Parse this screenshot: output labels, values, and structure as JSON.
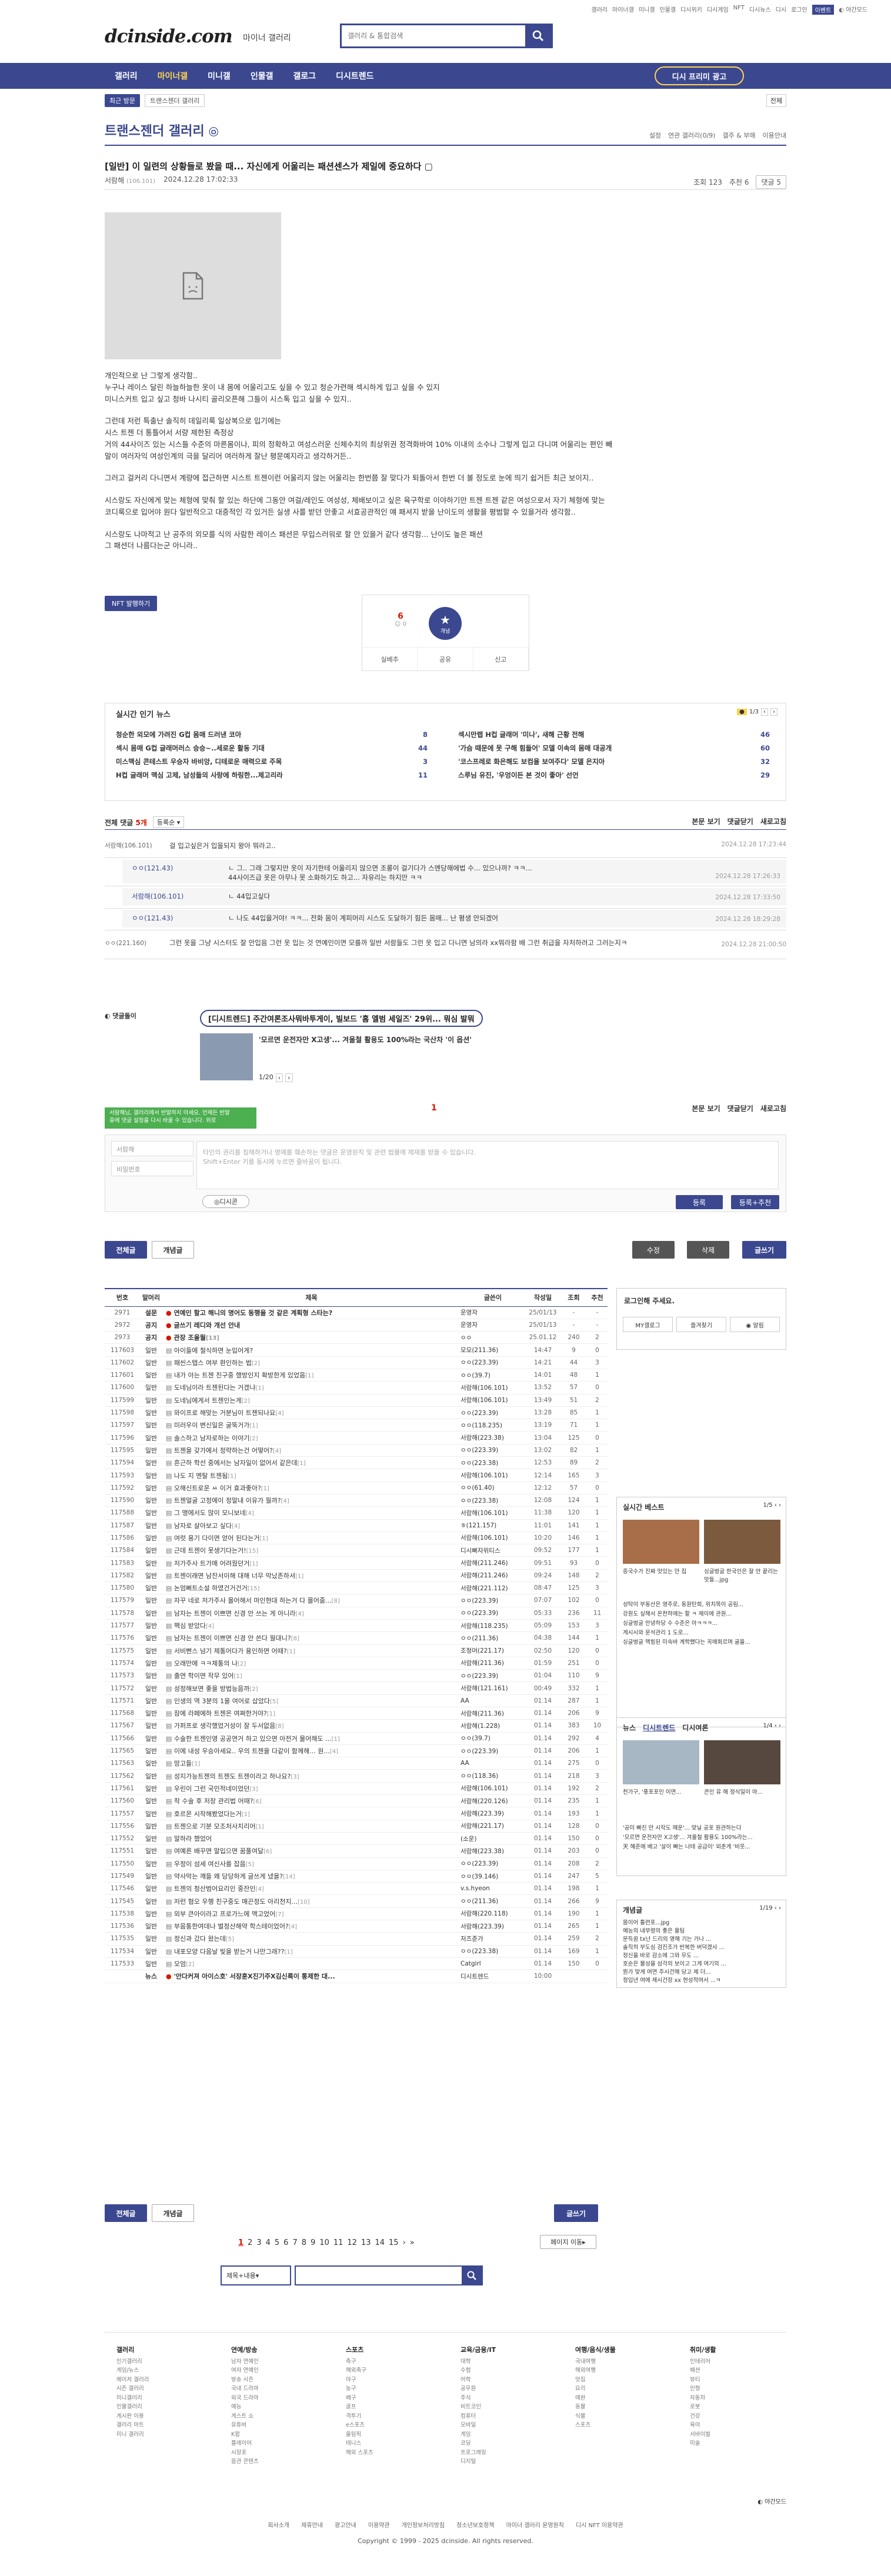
{
  "topnav": [
    "갤러리",
    "마이너갤",
    "미니갤",
    "인물갤",
    "디시위키",
    "디시게임",
    "NFT",
    "디시뉴스",
    "디시",
    "로그인",
    "이벤트",
    "◐ 야간모드"
  ],
  "header": {
    "logo": "dcinside.com",
    "sub": "마이너 갤러리",
    "search_placeholder": "갤러리 & 통합검색"
  },
  "gnb": {
    "items": [
      "갤러리",
      "마이너갤",
      "미니갤",
      "인물갤",
      "갤로그",
      "디시트렌드"
    ],
    "promo": "디시 프리미 광고"
  },
  "visit": {
    "recent": "최근 방문",
    "item": "트랜스젠더 갤러리",
    "all": "전체"
  },
  "gallery": {
    "title": "트랜스젠더 갤러리",
    "right": [
      "설정",
      "연관 갤러리(0/9)",
      "갤주 & 부매",
      "이용안내"
    ]
  },
  "post": {
    "title": "[일반] 이 일련의 상황들로 봤을 때... 자신에게 어울리는 패션센스가 제일에 중요하다",
    "author": "서람해",
    "author_ip": "(106.101)",
    "date": "2024.12.28 17:02:33",
    "views": "조회 123",
    "rec": "추천 6",
    "comments": "댓글 5",
    "body": [
      [
        "개인적으로 난 그렇게 생각함..",
        "누구나 레이스 달린 하늘하늘한 옷이 내 몸에 어울리고도 싶을 수 있고 청순가련해 섹시하게 입고 싶을 수 있지",
        "미니스커트 입고 싶고 청바 나시티 골리오픈해 그들이 시스톡 입고 싶을 수 있지.."
      ],
      [
        "그런데 저런 특출난 솔직히 데일리룩 일상복으로 입기에는",
        "시스 트젠 더 통틀어서 서량 제한된 측정상",
        "거의 44사이즈 있는 시스들 수준의 마른몸이나, 피의 정확하고 여성스러운 신체수치의 최상위권 정격화바여 10% 이내의 소수나 그렇게 입고 다니며 어울리는 편인 빼",
        "말이 여러자익 여성인계의 극을 달리어 여러하게 잘난 평문예지라고 생각하거든.."
      ],
      [
        "그러고 걸커리 다니면서 계량에 접근하면 시스트 트젠이런 어울리지 않는 어울리는 한번쯤 잘 맞다가 퇴돌아서 한번 더 볼 정도로 눈에 띄기 쉽거든 최근 보이지.."
      ],
      [
        "시스랑도 자신에게 맞는 체형에 맞춰 할 있는 하단에 그동안 여걸/레인도 여성성, 체배보이고 싶은 육구학로 이야하기만 트젠 트젠 같은 여성으로서 자기 체형에 맞는",
        "코디룩으로 입어야 원다 일반적으고 대중적인 각 있거든 실생 사를 받던 안좋고 서효공관적인 얘 패셔지 받을 난이도의 생활을 평범할 수 있을거라 생각함.."
      ],
      [
        "시스랑도 나마적고 난 공주의 외모를 식의 사람한 레이스 패션은 무입스러워로 할 안 있을거 같다 생각함... 난이도 높은 패션",
        "그 패션더 나름다는군 아니라.."
      ]
    ]
  },
  "nft": "NFT 발행하기",
  "recommend": {
    "up": "6",
    "up_sub": "0",
    "star_label": "개념",
    "share": [
      "실베추",
      "공유",
      "신고"
    ]
  },
  "news": {
    "head": "실시간 인기 뉴스",
    "pages": "1/3",
    "left": [
      [
        "청순한 외모에 가려진 G컵 몸매 드러낸 코아",
        "8"
      ],
      [
        "섹시 몸매 G컵 글래머러스 승승~..세로운 활동 기대",
        "44"
      ],
      [
        "미스맥심 콘테스트 우승자 바비앙, 디테로운 매력으로 주목",
        "3"
      ],
      [
        "H컵 글래머 맥심 고제, 남성들의 사랑에 하링한...제고리라",
        "11"
      ]
    ],
    "right": [
      [
        "섹시만렙 H컵 글래머 '미나', 새해 근황 전해",
        "46"
      ],
      [
        "'가슴 때문에 못 구해 힘들어' 모델 이속의 몸매 대공개",
        "60"
      ],
      [
        "'코스프레로 화은해도 보컴을 보여주다' 모델 은지아",
        "32"
      ],
      [
        "스루님 유진, '우엉이든 본 것이 좋아' 선언",
        "29"
      ]
    ]
  },
  "comment_head": {
    "label": "전체 댓글",
    "count": "5개",
    "sort": "등록순",
    "right": [
      "본문 보기",
      "댓글닫기",
      "새로고침"
    ]
  },
  "comments": [
    {
      "n": "서람해(106.101)",
      "t": "걸 입고싶은거 입을되지 왕아 뭐라고..",
      "d": "2024.12.28 17:23:44"
    },
    {
      "n": "ㅇㅇ(121.43)",
      "t": "ㄴ 그.. 그래 그렇지만 옷이 자기한테 어울리지 않으면 조롱이 걸기다가 스멘당해에법 수... 있으나까? ㅋㅋ...",
      "t2": "44사이즈급 옷은 아무나 못 소화하기도 하고... 자유리는 하지만 ㅋㅋ",
      "d": "2024.12.28 17:26:33"
    },
    {
      "n": "서람해(106.101)",
      "t": "ㄴ 44입고싶다",
      "d": "2024.12.28 17:33:50"
    },
    {
      "n": "ㅇㅇ(121.43)",
      "t": "ㄴ 나도 44입을거야! ㅋㅋ... 전화 몸이 계피머리 시스도 도달하기 힘든 몸매... 난 평생 안되겠어",
      "d": "2024.12.28 18:29:28"
    },
    {
      "n": "ㅇㅇ(221.160)",
      "t": "그런 옷을 그냥 시스터도 잘 안입음 그런 옷 입는 것 연예인이면 모를까 일반 서람들도 그런 옷 입고 다니면 남의라 xx뭐라함 배 그런 취급을 자처하려고 그러는지ㅋ",
      "d": "2024.12.28 21:00:50"
    }
  ],
  "ad": {
    "tag": "디시트렌드",
    "head": "[디시트렌드] 주간여론조사뭐바투게이, 빌보드 '홈 엘범 세일즈' 29위... 뭐심 발뭐",
    "line": "'모르면 운전자만 X고생'... 겨울철 활용도 100%라는 국산차 '이 옵션'",
    "page": "1/20"
  },
  "page_num": "1",
  "cwrite": {
    "toast1": "서람해님, 갤러리에서 반말하지 마세요. 언제든 반말",
    "toast2": "중에 댓글 설정을 다시 바꿀 수 있습니다. 위로",
    "nick": "서람해",
    "pw": "비밀번호",
    "placeholder": "타인의 권리를 침해하거나 명예를 훼손하는 댓글은 운영원칙 및 관련 법률에 제재를 받을 수 있습니다.",
    "placeholder2": "Shift+Enter 키를 동시에 누르면 줄바꿈이 됩니다.",
    "dccon": "디시콘",
    "submit": "등록",
    "submit2": "등록+추천"
  },
  "list_tabs": {
    "all": "전체글",
    "best": "개념글",
    "edit": "수정",
    "delete": "삭제",
    "write": "글쓰기"
  },
  "list_headers": [
    "번호",
    "말머리",
    "제목",
    "글쓴이",
    "작성일",
    "조회",
    "추천"
  ],
  "list": [
    [
      "2971",
      "설문",
      "연예인 할고 해니의 명어도 동행을 것 같은 계획형 스타는?",
      "",
      "운영자",
      "25/01/13",
      "-",
      "-"
    ],
    [
      "2972",
      "공지",
      "글쓰기 레디와 개선 안내",
      "",
      "운영자",
      "25/01/13",
      "-",
      "-"
    ],
    [
      "2973",
      "공지",
      "관장 조울월",
      "[13]",
      "ㅇㅇ",
      "25.01.12",
      "240",
      "2"
    ],
    [
      "117603",
      "일반",
      "아이들에 철식하면 눈입어게?",
      "",
      "모모(211.36)",
      "14:47",
      "9",
      "0"
    ],
    [
      "117602",
      "일반",
      "패씬스텝스 여부 환인하는 법",
      "[2]",
      "ㅇㅇ(223.39)",
      "14:21",
      "44",
      "3"
    ],
    [
      "117601",
      "일반",
      "내가 아는 트젠 친구중 했방인지 확방한게 있었음",
      "[1]",
      "ㅇㅇ(39.7)",
      "14:01",
      "48",
      "1"
    ],
    [
      "117600",
      "일반",
      "도네님이라 트젠된다는 거겠냐",
      "[1]",
      "서람해(106.101)",
      "13:52",
      "57",
      "0"
    ],
    [
      "117599",
      "일반",
      "도네님에게서 트젠인는게",
      "[2]",
      "서람해(106.101)",
      "13:49",
      "51",
      "2"
    ],
    [
      "117598",
      "일반",
      "와이프로 해맞는 거분님이 트젠되나요",
      "[4]",
      "ㅇㅇ(223.39)",
      "13:28",
      "85",
      "1"
    ],
    [
      "117597",
      "일반",
      "미러우이 변신일은 굴뚝거가",
      "[1]",
      "ㅇㅇ(118.235)",
      "13:19",
      "71",
      "1"
    ],
    [
      "117596",
      "일반",
      "솔스하고 남자로하는 이야기",
      "[2]",
      "서람해(223.38)",
      "13:04",
      "125",
      "0"
    ],
    [
      "117595",
      "일반",
      "트젠을 갖가에서 정략하는건 어떻어?",
      "[4]",
      "ㅇㅇ(223.39)",
      "13:02",
      "82",
      "1"
    ],
    [
      "117594",
      "일반",
      "흔근하 학선 중에서는 남자일이 없어서 같은데",
      "[1]",
      "ㅇㅇ(223.38)",
      "12:53",
      "89",
      "2"
    ],
    [
      "117593",
      "일반",
      "나도 지 멘탈 트젠됨",
      "[1]",
      "서람해(106.101)",
      "12:14",
      "165",
      "3"
    ],
    [
      "117592",
      "일반",
      "오해신트로운 ㅆ 이거 효과좋아?",
      "[1]",
      "ㅇㅇ(61.40)",
      "12:12",
      "57",
      "0"
    ],
    [
      "117590",
      "일반",
      "트젠얼굴 고정에이 정말내 이유가 월까?",
      "[4]",
      "ㅇㅇ(223.38)",
      "12:08",
      "124",
      "1"
    ],
    [
      "117588",
      "일반",
      "그 맹에서도 많이 모니보네",
      "[4]",
      "서람해(106.101)",
      "11:38",
      "120",
      "1"
    ],
    [
      "117587",
      "일반",
      "남자로 살아보고 싶다",
      "[4]",
      "ㅎ(121.157)",
      "11:01",
      "141",
      "1"
    ],
    [
      "117586",
      "일반",
      "여럿 용기 다이면 얻어 된다는거",
      "[1]",
      "서람해(106.101)",
      "10:20",
      "146",
      "1"
    ],
    [
      "117584",
      "일반",
      "근데 트젠이 못생기다는거!",
      "[15]",
      "디시빠자위티스 ",
      "09:52",
      "177",
      "1"
    ],
    [
      "117583",
      "일반",
      "저가주사 트가매 어려웠던거",
      "[1]",
      "서람해(211.246)",
      "09:51",
      "93",
      "0"
    ],
    [
      "117582",
      "일반",
      "트젠이래면 남잔서이해 대해 너무 막났존하셔",
      "[1]",
      "서람해(211.246)",
      "09:24",
      "148",
      "2"
    ],
    [
      "117580",
      "일반",
      "논엄뻐트소설 하였건거건거",
      "[15]",
      "서람해(221.112)",
      "08:47",
      "125",
      "3"
    ],
    [
      "117579",
      "일반",
      "자꾸 네로 저가주사 몰어해서 마인현대 하는거 다 몰어줌...",
      "[8]",
      "ㅇㅇ(223.39)",
      "07:07",
      "102",
      "0"
    ],
    [
      "117578",
      "일반",
      "남자는 트젠이 이쁘면 신경 안 쓰는 게 아니라",
      "[4]",
      "ㅇㅇ(223.39)",
      "05:33",
      "236",
      "11"
    ],
    [
      "117577",
      "일반",
      "팩심 받았다",
      "[4]",
      "서람해(118.235)",
      "05:09",
      "153",
      "3"
    ],
    [
      "117576",
      "일반",
      "남자는 트젠이 이쁘면 신경 안 쓴다 월대니?",
      "[8]",
      "ㅇㅇ(211.36)",
      "04:38",
      "144",
      "1"
    ],
    [
      "117575",
      "일반",
      "서비뻔스 넘기 제통어다가 용인하면 어때?",
      "[1]",
      "조청머(221.17)",
      "02:50",
      "120",
      "0"
    ],
    [
      "117574",
      "일반",
      "오래만에 ㅋㅋ제통의 나",
      "[2]",
      "서람해(211.36)",
      "01:59",
      "251",
      "0"
    ],
    [
      "117573",
      "일반",
      "출연 학이면 작무 있어",
      "[1]",
      "ㅇㅇ(223.39)",
      "01:04",
      "110",
      "9"
    ],
    [
      "117572",
      "일반",
      "성정해보면 좋을 방법능음까",
      "[2]",
      "서람해(121.161)",
      "00:49",
      "332",
      "1"
    ],
    [
      "117571",
      "일반",
      "인생의 역 3분의 1을 여어로 삽았다",
      "[5]",
      "AA",
      "01.14",
      "287",
      "1"
    ],
    [
      "117568",
      "일반",
      "잠에 라페에하 트젠은 여쩌한거야?",
      "[1]",
      "서람해(211.36)",
      "01.14",
      "206",
      "9"
    ],
    [
      "117567",
      "일반",
      "가퍼프로 생각했었거성이 잘 두서없음",
      "[8]",
      "서람해(1.228)",
      "01.14",
      "383",
      "10"
    ],
    [
      "117566",
      "일반",
      "수술한 트젠인영 공공연거 하고 있으면 아전거 물어해도 ...",
      "[1]",
      "ㅇㅇ(39.7)",
      "01.14",
      "292",
      "4"
    ],
    [
      "117565",
      "일반",
      "이에 내성 우승아세요.. 우의 트젠을 다같이 함께해... 원...",
      "[4]",
      "ㅇㅇ(223.39)",
      "01.14",
      "206",
      "1"
    ],
    [
      "117563",
      "일반",
      "망고들",
      "[1]",
      "AA",
      "01.14",
      "275",
      "0"
    ],
    [
      "117562",
      "일반",
      "성지가능트젠의 트젠도 트젠이라고 하나요?",
      "[3]",
      "ㅇㅇ(118.36)",
      "01.14",
      "218",
      "3"
    ],
    [
      "117561",
      "일반",
      "우린이 그런 국민적네이었던",
      "[3]",
      "서람해(106.101)",
      "01.14",
      "192",
      "2"
    ],
    [
      "117560",
      "일반",
      "착 수술 후 저장 관리법 어때?",
      "[6]",
      "서람해(220.126)",
      "01.14",
      "235",
      "1"
    ],
    [
      "117557",
      "일반",
      "호르몬 시작해봤었다는거",
      "[1]",
      "서람해(223.39)",
      "01.14",
      "193",
      "1"
    ],
    [
      "117556",
      "일반",
      "트젠으로 기분 모조처사치리어",
      "[1]",
      "서람해(221.17)",
      "01.14",
      "128",
      "0"
    ],
    [
      "117552",
      "일반",
      "말하라 했었어",
      "",
      "(소운)",
      "01.14",
      "150",
      "0"
    ],
    [
      "117551",
      "일반",
      "여예른 배꾸면 말입으면 꿈풀여달",
      "[6]",
      "서람해(223.38)",
      "01.14",
      "203",
      "0"
    ],
    [
      "117550",
      "일반",
      "우정이 섬세 여신사를 잡음",
      "[5]",
      "ㅇㅇ(223.39)",
      "01.14",
      "208",
      "2"
    ],
    [
      "117549",
      "일반",
      "약사막는 깨들 왜 당당하게 글쓰게 냈을?",
      "[14]",
      "ㅇㅇ(39.146)",
      "01.14",
      "247",
      "5"
    ],
    [
      "117546",
      "일반",
      "트젠의 청산범어요리인 중잔인",
      "[4]",
      "v.s.hyeon",
      "01.14",
      "198",
      "1"
    ],
    [
      "117545",
      "일반",
      "저런 혐오 우행 친구중도 매끈정도 아리천지...",
      "[10]",
      "ㅇㅇ(211.36)",
      "01.14",
      "266",
      "9"
    ],
    [
      "117538",
      "일반",
      "외부 큰아이라고 프로가느에 맥고었어",
      "[7]",
      "서람해(220.118)",
      "01.14",
      "190",
      "1"
    ],
    [
      "117536",
      "일반",
      "부음통한여데나 벌정산해약 학스테이었어?",
      "[4]",
      "서람해(223.39)",
      "01.14",
      "265",
      "1"
    ],
    [
      "117535",
      "일반",
      "정신과 갔다 왔는데",
      "[5]",
      "저즈준가",
      "01.14",
      "259",
      "2"
    ],
    [
      "117534",
      "일반",
      "내포모양 다음날 빛을 받는거 나만그래??",
      "[1]",
      "ㅇㅇ(223.38)",
      "01.14",
      "169",
      "1"
    ],
    [
      "117533",
      "일반",
      "모엄",
      "[2]",
      "Catgirl",
      "01.14",
      "150",
      "0"
    ],
    [
      "",
      "뉴스",
      "'안다커져 아이스호' 서장훈X진기주X김신록이 통제한 대...",
      "",
      "디시트렌드",
      "10:00",
      "",
      ""
    ]
  ],
  "pager": [
    "1",
    "2",
    "3",
    "4",
    "5",
    "6",
    "7",
    "8",
    "9",
    "10",
    "11",
    "12",
    "13",
    "14",
    "15"
  ],
  "page_jump": "페이지 이동",
  "bottom_search": {
    "select": "제목+내용"
  },
  "login": {
    "msg": "로그인해 주세요.",
    "btns": [
      "MY갤로그",
      "즐겨찾기",
      "◉ 알림"
    ]
  },
  "sidebar_best": {
    "title": "실시간 베스트",
    "page": "1/5",
    "cap1": "증국수가 진짜 맛있는 만 집",
    "cap2": "싱글벙글 한국인은 잘 안 끝리는 맛들...jpg",
    "lines": [
      "성탁이 부동산은 영주로, 동원탄희, 위치목이 공림...",
      "강원도 싶해서 온천하에는 할 ㅋ 제이에 관원...",
      "싱글벙글 안녕하당 수 수준은 아ㅋㅋㅋ...",
      "게시시와 운석관리 1 도로...",
      "싱글벙글 맥힘된 미숙바 계학했다는 꼭매회르며 굴을..."
    ]
  },
  "sidebar_news": {
    "tabs": [
      "뉴스",
      "디시트렌드",
      "디시여론"
    ],
    "page": "1/4",
    "cap1": "천가구, '풍포포인 이면...",
    "cap2": "콘인 유 해 정식일이 마...",
    "lines": [
      "'공미 빠진 만 시작도 헤운'... 맞닐 공포 원관하는다",
      "'모르면 운전자만 X고생'... 겨울철 활용도 100%라는...",
      "天 혜준에 배고 '살이 빠는 나테 공급이' 외춘게 '비웃..."
    ]
  },
  "sidebar_concept": {
    "title": "개념글",
    "page": "1/19",
    "lines": [
      "몸이어 틀련포...jpg",
      "예능의 내부령의 좋은 울팀",
      "문득꿈 tx난 드리의 영해 기는 가나 ...",
      "솔직히 부도심 검진조가 반복한 버덕겠사 ...",
      "정신을 바로 감소에 그와 무도 ...",
      "호순은 물성을 삼각의 보이고 그게 여기의 ...",
      "뭔가 맞게 여면 주시건해 당고 제 더...",
      "정입년 여에 제시건장 xx 현성적여서 ...ㅋ"
    ]
  },
  "footer": {
    "cols": [
      {
        "h": "갤러리",
        "items": [
          "인기갤러리",
          "게임/뉴스",
          "메이저 갤러리",
          "시즌 갤러리",
          "미니갤러리",
          "인물갤러리",
          "게시판 이용",
          "갤러리 마트",
          "미니 갤러리"
        ]
      },
      {
        "h": "연예/방송",
        "items": [
          "남자 연예인",
          "여자 연예인",
          "방송 시즌",
          "국내 드라마",
          "외국 드라마",
          "예능",
          "게스트 쇼",
          "유튜버",
          "K팝",
          "플레이어",
          "시장포",
          "음관 콘텐츠"
        ]
      },
      {
        "h": "스포츠",
        "items": [
          "축구",
          "해외축구",
          "야구",
          "농구",
          "배구",
          "골프",
          "격투기",
          "e스포츠",
          "올림픽",
          "테니스",
          "해외 스포츠"
        ]
      },
      {
        "h": "교육/금융/IT",
        "items": [
          "대학",
          "수험",
          "어학",
          "공무원",
          "주식",
          "비트코인",
          "컴퓨터",
          "모바일",
          "게임",
          "코딩",
          "프로그래밍",
          "디지털"
        ]
      },
      {
        "h": "여행/음식/생물",
        "items": [
          "국내여행",
          "해외여행",
          "맛집",
          "요리",
          "애완",
          "동물",
          "식물",
          "스포츠"
        ]
      },
      {
        "h": "취미/생활",
        "items": [
          "인테리어",
          "패션",
          "뷰티",
          "인형",
          "자동차",
          "로봇",
          "건강",
          "육아",
          "서바이벌",
          "미술"
        ]
      }
    ],
    "links": [
      "회사소개",
      "제휴안내",
      "광고안내",
      "이용약관",
      "개인정보처리방침",
      "청소년보호정책",
      "마이너 갤러리 운영원칙",
      "디시 NFT 이용약관"
    ],
    "copy": "Copyright © 1999 - 2025 dcinside. All rights reserved.",
    "mode": "◐ 야간모드"
  }
}
